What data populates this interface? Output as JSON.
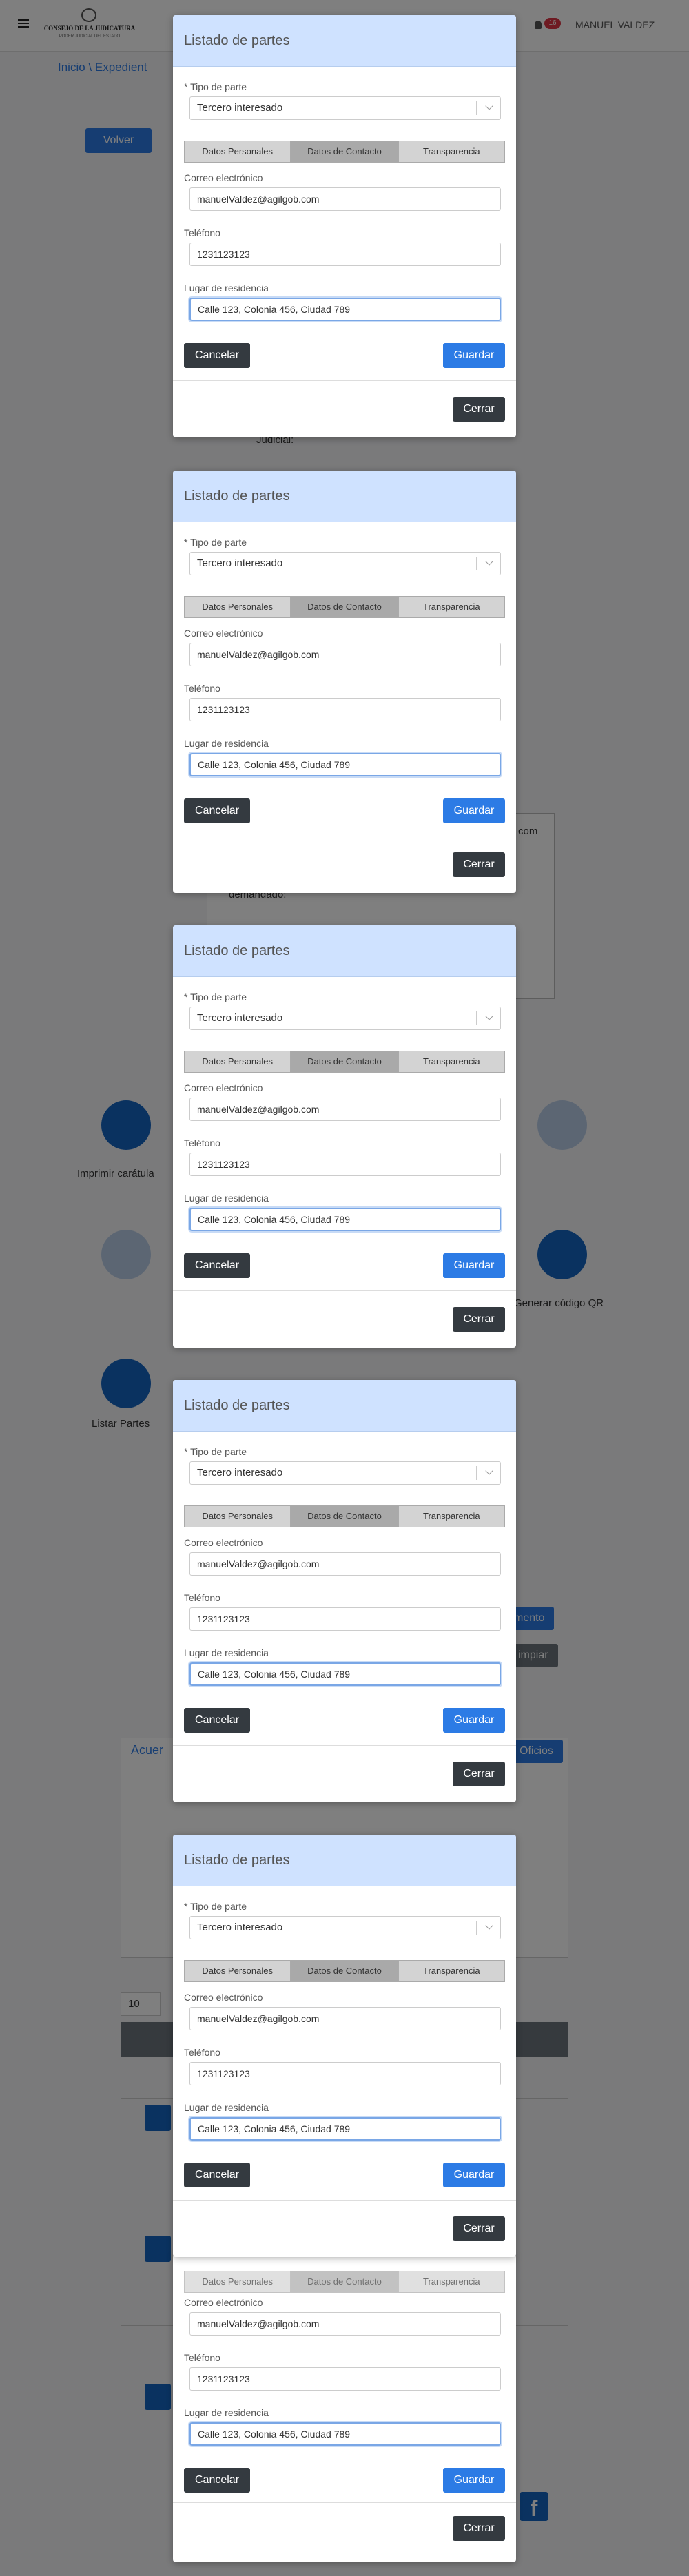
{
  "navbar": {
    "logo_line1": "CONSEJO DE LA JUDICATURA",
    "logo_line2": "PODER JUDICIAL DEL ESTADO",
    "notif_count": "16",
    "user_name": "MANUEL VALDEZ"
  },
  "background": {
    "breadcrumb": "Inicio \\ Expedient",
    "back_label": "Volver",
    "judicial_label": "Judicial:",
    "email_partial": "com",
    "demandado_label": "demandado:",
    "print_caratula": "Imprimir carátula",
    "generate_qr": "Generar código QR",
    "list_parts": "Listar Partes",
    "acuerdos": "Acuer",
    "oficios": "Oficios",
    "mento": "mento",
    "limpiar": "impiar",
    "page_size": "10"
  },
  "modals": [
    {
      "title": "Listado de partes"
    },
    {
      "title": "Listado de partes"
    },
    {
      "title": "Listado de partes"
    },
    {
      "title": "Listado de partes"
    },
    {
      "title": "Listado de partes"
    }
  ],
  "form": {
    "tipo_label": "Tipo de parte",
    "tipo_required": "*",
    "tipo_value": "Tercero interesado",
    "tabs": [
      "Datos Personales",
      "Datos de Contacto",
      "Transparencia"
    ],
    "active_tab": "Datos de Contacto",
    "email_label": "Correo electrónico",
    "email_value": "manuelValdez@agilgob.com",
    "phone_label": "Teléfono",
    "phone_value": "1231123123",
    "address_label": "Lugar de residencia",
    "address_value": "Calle 123, Colonia 456, Ciudad 789",
    "cancel": "Cancelar",
    "save": "Guardar",
    "close": "Cerrar"
  },
  "colors": {
    "header_bg": "#cfe2ff",
    "primary": "#2c7be5",
    "dark": "#343a40"
  }
}
